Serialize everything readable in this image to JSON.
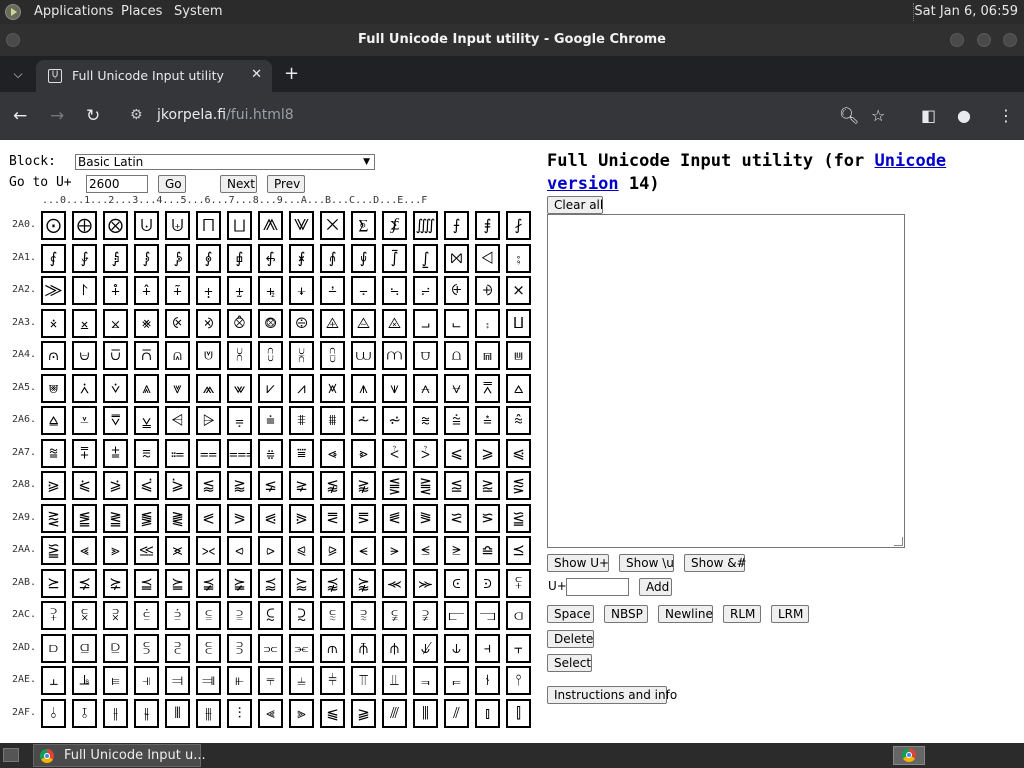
{
  "panel": {
    "menus": [
      "Applications",
      "Places",
      "System"
    ],
    "clock": "Sat Jan  6, 06:59"
  },
  "window": {
    "title": "Full Unicode Input utility - Google Chrome"
  },
  "tab": {
    "title": "Full Unicode Input utility",
    "favicon": "Ụ"
  },
  "address": {
    "host": "jkorpela.fi",
    "path": "/fui.html8"
  },
  "icons": {
    "tab_list": "chevron-down-icon",
    "tab_close": "close-icon",
    "new_tab": "plus-icon",
    "back": "back-arrow-icon",
    "forward": "forward-arrow-icon",
    "reload": "reload-icon",
    "site_info": "tune-icon",
    "zoom": "zoom-icon",
    "bookmark": "star-icon",
    "side_panel": "side-panel-icon",
    "profile": "profile-icon",
    "menu": "kebab-menu-icon"
  },
  "form": {
    "block_label": "Block:",
    "block_value": "Basic Latin",
    "goto_label": "Go to U+",
    "goto_value": "2600",
    "go": "Go",
    "next": "Next",
    "prev": "Prev"
  },
  "col_header": "...0...1...2...3...4...5...6...7...8...9...A...B...C...D...E...F",
  "grid": [
    {
      "label": "2A0.",
      "chars": [
        "⨀",
        "⨁",
        "⨂",
        "⨃",
        "⨄",
        "⨅",
        "⨆",
        "⨇",
        "⨈",
        "⨉",
        "⨊",
        "⨋",
        "⨌",
        "⨍",
        "⨎",
        "⨏"
      ]
    },
    {
      "label": "2A1.",
      "chars": [
        "⨐",
        "⨑",
        "⨒",
        "⨓",
        "⨔",
        "⨕",
        "⨖",
        "⨗",
        "⨘",
        "⨙",
        "⨚",
        "⨛",
        "⨜",
        "⨝",
        "⨞",
        "⨟"
      ]
    },
    {
      "label": "2A2.",
      "chars": [
        "⨠",
        "⨡",
        "⨢",
        "⨣",
        "⨤",
        "⨥",
        "⨦",
        "⨧",
        "⨨",
        "⨩",
        "⨪",
        "⨫",
        "⨬",
        "⨭",
        "⨮",
        "⨯"
      ]
    },
    {
      "label": "2A3.",
      "chars": [
        "⨰",
        "⨱",
        "⨲",
        "⨳",
        "⨴",
        "⨵",
        "⨶",
        "⨷",
        "⨸",
        "⨹",
        "⨺",
        "⨻",
        "⨼",
        "⨽",
        "⨾",
        "⨿"
      ]
    },
    {
      "label": "2A4.",
      "chars": [
        "⩀",
        "⩁",
        "⩂",
        "⩃",
        "⩄",
        "⩅",
        "⩆",
        "⩇",
        "⩈",
        "⩉",
        "⩊",
        "⩋",
        "⩌",
        "⩍",
        "⩎",
        "⩏"
      ]
    },
    {
      "label": "2A5.",
      "chars": [
        "⩐",
        "⩑",
        "⩒",
        "⩓",
        "⩔",
        "⩕",
        "⩖",
        "⩗",
        "⩘",
        "⩙",
        "⩚",
        "⩛",
        "⩜",
        "⩝",
        "⩞",
        "⩟"
      ]
    },
    {
      "label": "2A6.",
      "chars": [
        "⩠",
        "⩡",
        "⩢",
        "⩣",
        "⩤",
        "⩥",
        "⩦",
        "⩧",
        "⩨",
        "⩩",
        "⩪",
        "⩫",
        "⩬",
        "⩭",
        "⩮",
        "⩯"
      ]
    },
    {
      "label": "2A7.",
      "chars": [
        "⩰",
        "⩱",
        "⩲",
        "⩳",
        "⩴",
        "⩵",
        "⩶",
        "⩷",
        "⩸",
        "⩹",
        "⩺",
        "⩻",
        "⩼",
        "⩽",
        "⩾",
        "⩿"
      ]
    },
    {
      "label": "2A8.",
      "chars": [
        "⪀",
        "⪁",
        "⪂",
        "⪃",
        "⪄",
        "⪅",
        "⪆",
        "⪇",
        "⪈",
        "⪉",
        "⪊",
        "⪋",
        "⪌",
        "⪍",
        "⪎",
        "⪏"
      ]
    },
    {
      "label": "2A9.",
      "chars": [
        "⪐",
        "⪑",
        "⪒",
        "⪓",
        "⪔",
        "⪕",
        "⪖",
        "⪗",
        "⪘",
        "⪙",
        "⪚",
        "⪛",
        "⪜",
        "⪝",
        "⪞",
        "⪟"
      ]
    },
    {
      "label": "2AA.",
      "chars": [
        "⪠",
        "⪡",
        "⪢",
        "⪣",
        "⪤",
        "⪥",
        "⪦",
        "⪧",
        "⪨",
        "⪩",
        "⪪",
        "⪫",
        "⪬",
        "⪭",
        "⪮",
        "⪯"
      ]
    },
    {
      "label": "2AB.",
      "chars": [
        "⪰",
        "⪱",
        "⪲",
        "⪳",
        "⪴",
        "⪵",
        "⪶",
        "⪷",
        "⪸",
        "⪹",
        "⪺",
        "⪻",
        "⪼",
        "⪽",
        "⪾",
        "⪿"
      ]
    },
    {
      "label": "2AC.",
      "chars": [
        "⫀",
        "⫁",
        "⫂",
        "⫃",
        "⫄",
        "⫅",
        "⫆",
        "⫇",
        "⫈",
        "⫉",
        "⫊",
        "⫋",
        "⫌",
        "⫍",
        "⫎",
        "⫏"
      ]
    },
    {
      "label": "2AD.",
      "chars": [
        "⫐",
        "⫑",
        "⫒",
        "⫓",
        "⫔",
        "⫕",
        "⫖",
        "⫗",
        "⫘",
        "⫙",
        "⫚",
        "⫛",
        "⫝̸",
        "⫝",
        "⫞",
        "⫟"
      ]
    },
    {
      "label": "2AE.",
      "chars": [
        "⫠",
        "⫡",
        "⫢",
        "⫣",
        "⫤",
        "⫥",
        "⫦",
        "⫧",
        "⫨",
        "⫩",
        "⫪",
        "⫫",
        "⫬",
        "⫭",
        "⫮",
        "⫯"
      ]
    },
    {
      "label": "2AF.",
      "chars": [
        "⫰",
        "⫱",
        "⫲",
        "⫳",
        "⫴",
        "⫵",
        "⫶",
        "⫷",
        "⫸",
        "⫹",
        "⫺",
        "⫻",
        "⫼",
        "⫽",
        "⫾",
        "⫿"
      ]
    }
  ],
  "right": {
    "title_prefix": "Full Unicode Input utility (for ",
    "title_link": "Unicode version",
    "title_suffix": " 14)",
    "clear_all": "Clear all",
    "show_uplus": "Show U+",
    "show_u": "Show \\u",
    "show_amp": "Show &#",
    "uplus_label": "U+",
    "add": "Add",
    "space": "Space",
    "nbsp": "NBSP",
    "newline": "Newline",
    "rlm": "RLM",
    "lrm": "LRM",
    "delete": "Delete",
    "select": "Select",
    "instructions": "Instructions and info"
  },
  "taskbar": {
    "task_label": "Full Unicode Input u..."
  }
}
